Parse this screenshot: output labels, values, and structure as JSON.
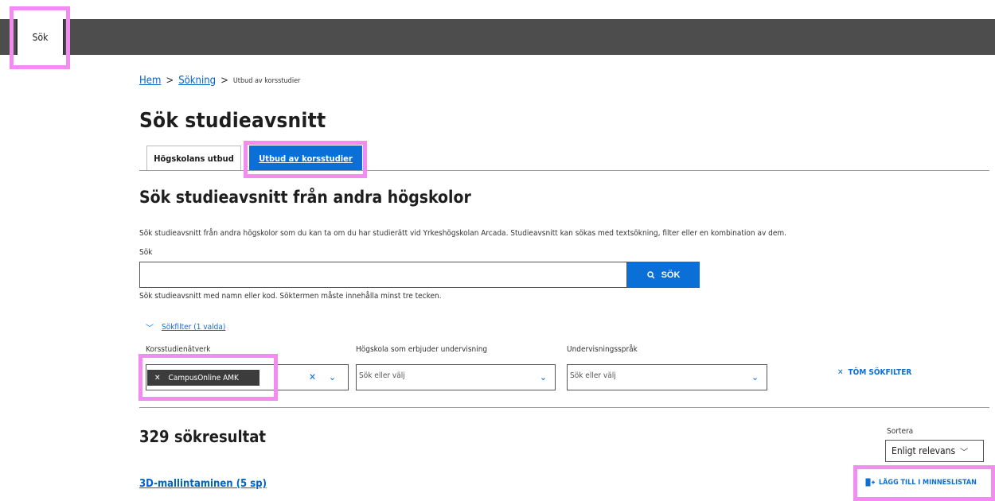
{
  "nav": {
    "tab_label": "Sök"
  },
  "breadcrumb": {
    "home": "Hem",
    "search": "Sökning",
    "current": "Utbud av korsstudier",
    "sep": ">"
  },
  "page": {
    "title": "Sök studieavsnitt"
  },
  "tabs": [
    {
      "label": "Högskolans utbud"
    },
    {
      "label": "Utbud av korsstudier"
    }
  ],
  "section": {
    "title": "Sök studieavsnitt från andra högskolor",
    "description": "Sök studieavsnitt från andra högskolor som du kan ta om du har studierätt vid Yrkeshögskolan Arcada. Studieavsnitt kan sökas med textsökning, filter eller en kombination av dem."
  },
  "search": {
    "label": "Sök",
    "value": "",
    "button_label": "SÖK",
    "hint": "Sök studieavsnitt med namn eller kod. Söktermen måste innehålla minst tre tecken."
  },
  "filters": {
    "toggle_label": "Sökfilter (1 valda)",
    "network": {
      "label": "Korsstudienätverk",
      "chip": "CampusOnline AMK"
    },
    "school": {
      "label": "Högskola som erbjuder undervisning",
      "placeholder": "Sök eller välj"
    },
    "language": {
      "label": "Undervisningsspråk",
      "placeholder": "Sök eller välj"
    },
    "clear_label": "TÖM SÖKFILTER"
  },
  "results": {
    "count_label": "329 sökresultat",
    "sort_label": "Sortera",
    "sort_value": "Enligt relevans",
    "first_title": "3D-mallintaminen (5 sp)",
    "add_memo_label": "LÄGG TILL I MINNESLISTAN"
  },
  "icons": {
    "search": "search-icon",
    "chevron_down": "chevron-down-icon",
    "close": "close-icon",
    "memo_add": "memo-add-icon"
  },
  "colors": {
    "accent": "#0a6fd6",
    "topbar": "#4d4d4d",
    "highlight": "#f28cf0"
  }
}
